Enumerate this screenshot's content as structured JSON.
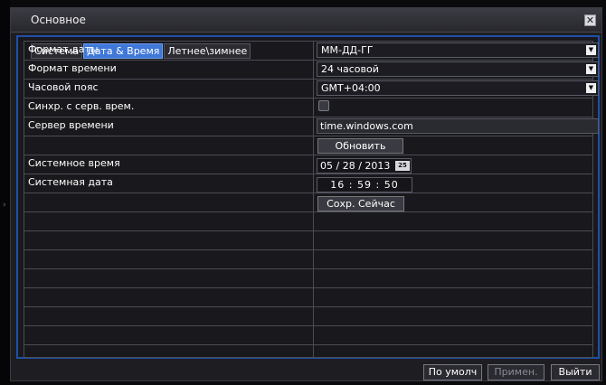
{
  "window": {
    "title": "Основное"
  },
  "tabs": [
    "Система",
    "Дата & Время",
    "Летнее\\зимнее"
  ],
  "rows": {
    "date_format": {
      "label": "Формат даты",
      "value": "ММ-ДД-ГГ"
    },
    "time_format": {
      "label": "Формат времени",
      "value": "24 часовой"
    },
    "timezone": {
      "label": "Часовой пояс",
      "value": "GMT+04:00"
    },
    "sync": {
      "label": "Синхр. с серв. врем.",
      "checked": false
    },
    "time_server": {
      "label": "Сервер времени",
      "value": "time.windows.com"
    },
    "update_button": "Обновить",
    "system_time": {
      "label": "Системное время",
      "value": "05 / 28 / 2013",
      "picker": "25"
    },
    "system_date": {
      "label": "Системная дата",
      "value": "16 : 59 : 50"
    },
    "save_now_button": "Сохр. Сейчас"
  },
  "footer": {
    "default_button": "По умолч",
    "apply_button": "Примен.",
    "exit_button": "Выйти"
  }
}
